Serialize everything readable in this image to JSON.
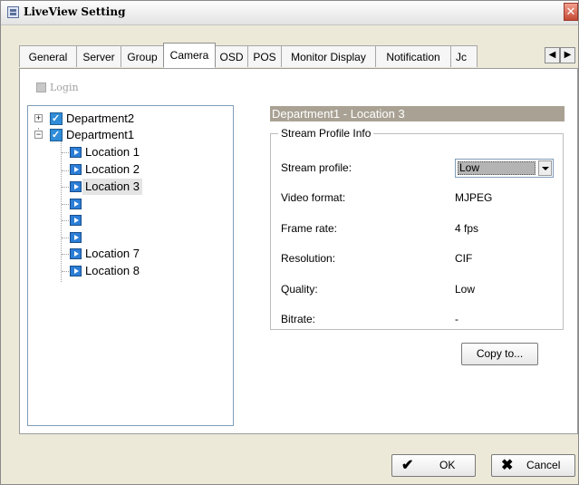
{
  "window": {
    "title": "LiveView Setting",
    "close_glyph": "✕"
  },
  "tabs": [
    {
      "label": "General"
    },
    {
      "label": "Server"
    },
    {
      "label": "Group"
    },
    {
      "label": "Camera",
      "active": true
    },
    {
      "label": "OSD"
    },
    {
      "label": "POS"
    },
    {
      "label": "Monitor Display"
    },
    {
      "label": "Notification"
    },
    {
      "label": "Jc"
    }
  ],
  "tab_scroll": {
    "left": "◀",
    "right": "▶"
  },
  "toolbar": {
    "login_label": "Login",
    "login_icon": "login-icon"
  },
  "tree": {
    "departments": [
      {
        "label": "Department2",
        "expanded": false,
        "expander": "+"
      },
      {
        "label": "Department1",
        "expanded": true,
        "expander": "−"
      }
    ],
    "locations": [
      {
        "label": "Location 1"
      },
      {
        "label": "Location 2"
      },
      {
        "label": "Location 3",
        "selected": true
      },
      {
        "label": ""
      },
      {
        "label": ""
      },
      {
        "label": ""
      },
      {
        "label": "Location 7"
      },
      {
        "label": "Location 8"
      }
    ]
  },
  "detail": {
    "header": "Department1 - Location 3",
    "group_title": "Stream Profile Info",
    "stream_profile": {
      "label": "Stream profile:",
      "value": "Low"
    },
    "fields": [
      {
        "label": "Video format:",
        "value": "MJPEG"
      },
      {
        "label": "Frame rate:",
        "value": "4 fps"
      },
      {
        "label": "Resolution:",
        "value": "CIF"
      },
      {
        "label": "Quality:",
        "value": "Low"
      },
      {
        "label": "Bitrate:",
        "value": "-"
      }
    ],
    "copy_button": "Copy to..."
  },
  "footer": {
    "ok_label": "OK",
    "cancel_label": "Cancel"
  },
  "colors": {
    "header_bar": "#a9a294",
    "dialog_bg": "#ece9d8",
    "tree_border": "#7f9db9",
    "camera_icon": "#2c7ed6"
  }
}
